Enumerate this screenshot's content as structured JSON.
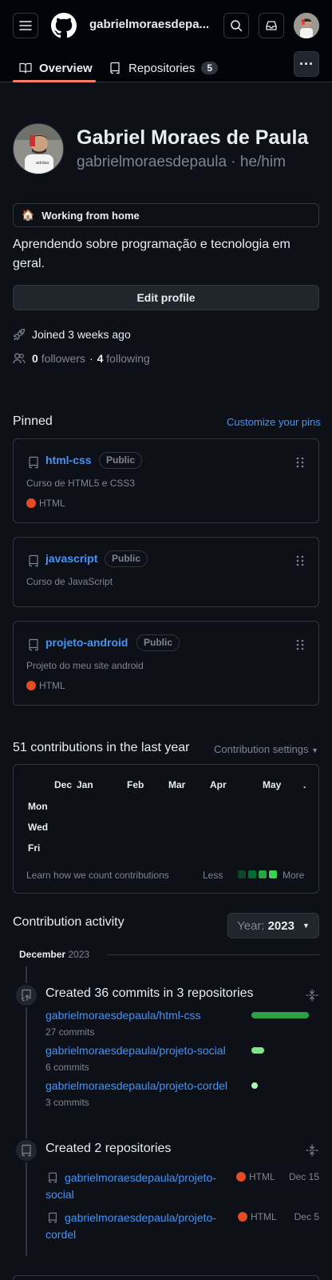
{
  "header": {
    "username": "gabrielmoraesdepa...",
    "tabs": [
      {
        "label": "Overview",
        "icon": "book-icon",
        "active": true
      },
      {
        "label": "Repositories",
        "icon": "repo-icon",
        "count": "5"
      }
    ],
    "more_label": "···"
  },
  "profile": {
    "name": "Gabriel Moraes de Paula",
    "login_line": "gabrielmoraesdepaula · he/him",
    "status_emoji": "🏠",
    "status_text": "Working from home",
    "bio": "Aprendendo sobre programação e tecnologia em geral.",
    "edit_button": "Edit profile",
    "joined": "Joined 3 weeks ago",
    "followers_count": "0",
    "followers_label": "followers",
    "separator": "·",
    "following_count": "4",
    "following_label": "following"
  },
  "pinned": {
    "title": "Pinned",
    "customize_link": "Customize your pins",
    "repos": [
      {
        "name": "html-css",
        "visibility": "Public",
        "description": "Curso de HTML5 e CSS3",
        "language": "HTML",
        "language_color": "#e34c26"
      },
      {
        "name": "javascript",
        "visibility": "Public",
        "description": "Curso de JavaScript"
      },
      {
        "name": "projeto-android",
        "visibility": "Public",
        "description": "Projeto do meu site android",
        "language": "HTML",
        "language_color": "#e34c26"
      }
    ]
  },
  "contributions": {
    "title": "51 contributions in the last year",
    "settings": "Contribution settings",
    "months": [
      "Dec",
      "Jan",
      "Feb",
      "Mar",
      "Apr",
      "May",
      "."
    ],
    "days": [
      "Mon",
      "Wed",
      "Fri"
    ],
    "learn_link": "Learn how we count contributions",
    "less": "Less",
    "more": "More",
    "legend_colors": [
      "#0e4429",
      "#006d32",
      "#26a641",
      "#39d353"
    ]
  },
  "activity": {
    "title": "Contribution activity",
    "year_label": "Year:",
    "year_value": "2023",
    "month": "December",
    "month_year": "2023",
    "commits_title": "Created 36 commits in 3 repositories",
    "commit_items": [
      {
        "repo": "gabrielmoraesdepaula/html-css",
        "count": "27 commits",
        "share": 0.75
      },
      {
        "repo": "gabrielmoraesdepaula/projeto-social",
        "count": "6 commits",
        "share": 0.17
      },
      {
        "repo": "gabrielmoraesdepaula/projeto-cordel",
        "count": "3 commits",
        "share": 0.08
      }
    ],
    "repos_title": "Created 2 repositories",
    "created_repos": [
      {
        "repo": "gabrielmoraesdepaula/projeto-social",
        "language": "HTML",
        "date": "Dec 15"
      },
      {
        "repo": "gabrielmoraesdepaula/projeto-cordel",
        "language": "HTML",
        "date": "Dec 5"
      }
    ]
  }
}
